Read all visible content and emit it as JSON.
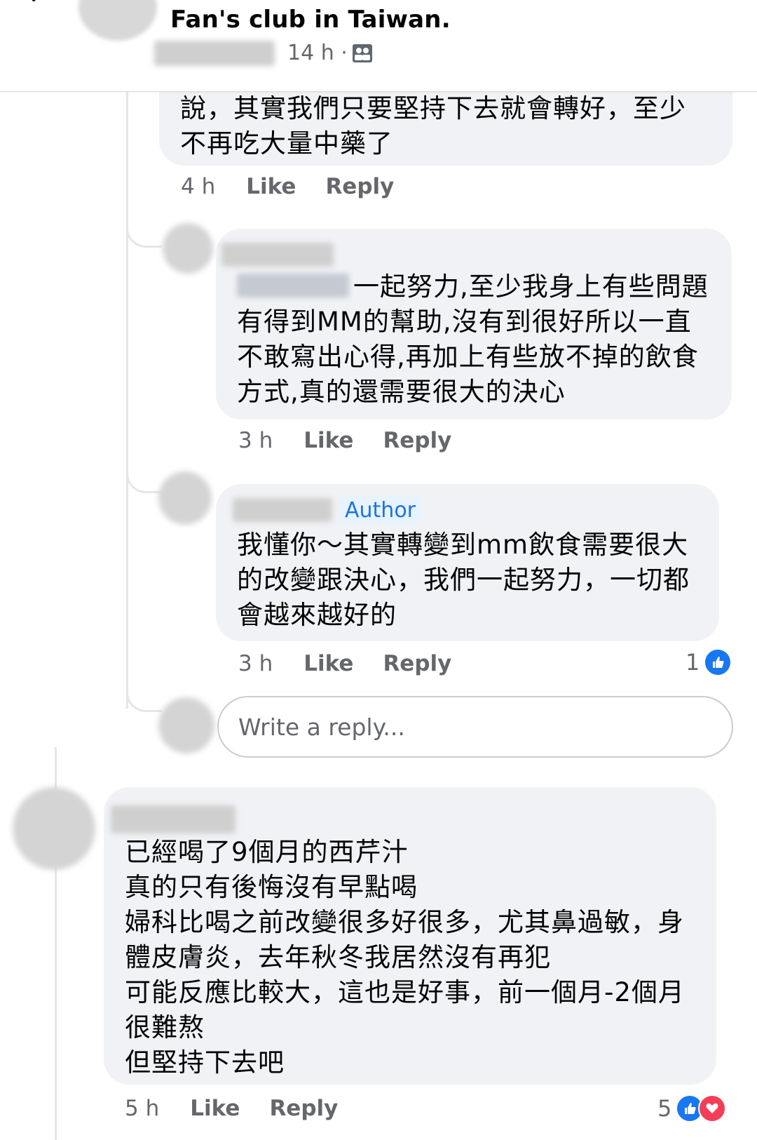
{
  "header": {
    "group_name": "Fan's club in Taiwan.",
    "time": "14 h ·",
    "privacy_icon": "group-members-icon"
  },
  "comments": [
    {
      "text": "說，其實我們只要堅持下去就會轉好，至少\n不再吃大量中藥了",
      "time": "4 h",
      "like": "Like",
      "reply": "Reply"
    },
    {
      "text": "一起努力,至少我身上有些問題\n有得到MM的幫助,沒有到很好所以一直\n不敢寫出心得,再加上有些放不掉的飲食\n方式,真的還需要很大的決心",
      "time": "3 h",
      "like": "Like",
      "reply": "Reply"
    },
    {
      "badge": "Author",
      "text": "我懂你～其實轉變到mm飲食需要很大\n的改變跟決心，我們一起努力，一切都\n會越來越好的",
      "time": "3 h",
      "like": "Like",
      "reply": "Reply",
      "reaction_count": "1"
    },
    {
      "text": "已經喝了9個月的西芹汁\n真的只有後悔沒有早點喝\n婦科比喝之前改變很多好很多，尤其鼻過敏，身\n體皮膚炎，去年秋冬我居然沒有再犯\n可能反應比較大，這也是好事，前一個月-2個月\n很難熬\n但堅持下去吧",
      "time": "5 h",
      "like": "Like",
      "reply": "Reply",
      "reaction_count": "5"
    }
  ],
  "reply_input": {
    "placeholder": "Write a reply..."
  },
  "colors": {
    "bubble": "#f0f2f5",
    "meta_text": "#65676b",
    "like_blue": "#1877f2",
    "love_red": "#f33e58",
    "author_badge_bg": "#e7f3ff",
    "author_badge_text": "#1b74e4"
  }
}
